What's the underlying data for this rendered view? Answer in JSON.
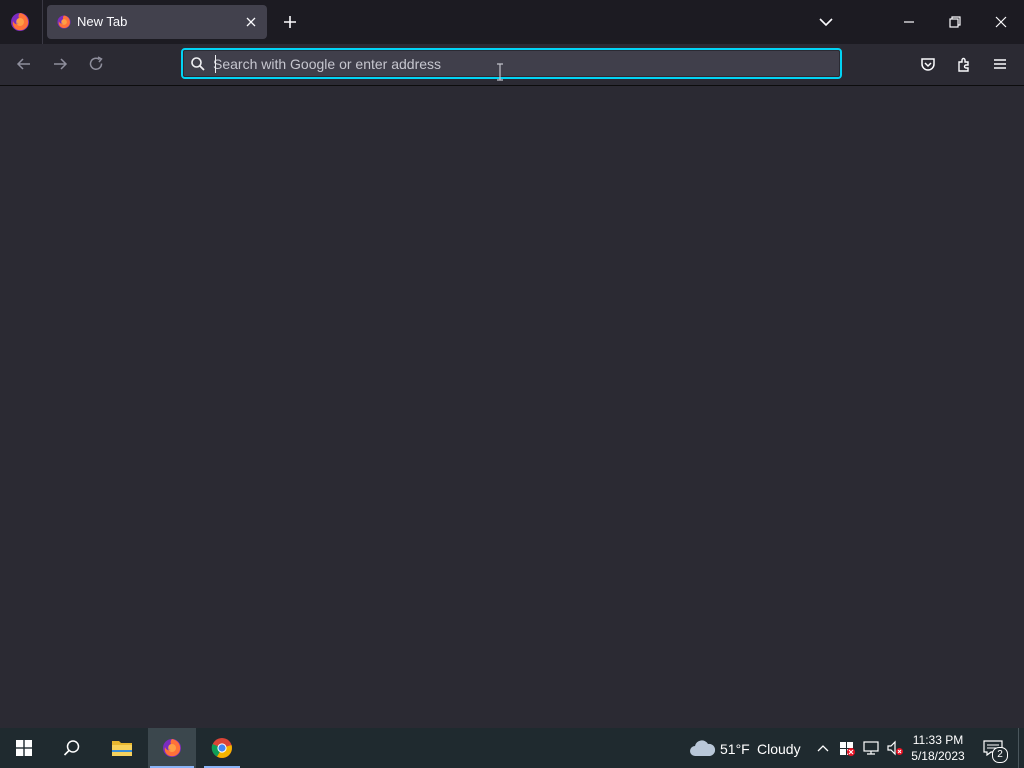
{
  "browser": {
    "tab": {
      "title": "New Tab",
      "close_icon": "close-icon",
      "favicon": "firefox-icon"
    },
    "new_tab_icon": "plus-icon",
    "tab_list_icon": "chevron-down-icon",
    "window_controls": [
      "minimize-icon",
      "restore-icon",
      "close-icon"
    ],
    "nav": {
      "back_icon": "arrow-left-icon",
      "forward_icon": "arrow-right-icon",
      "reload_icon": "reload-icon"
    },
    "urlbar": {
      "placeholder": "Search with Google or enter address",
      "value": "",
      "icon": "search-icon"
    },
    "toolbar_icons": [
      "pocket-icon",
      "extensions-icon",
      "menu-icon"
    ]
  },
  "taskbar": {
    "items": [
      "windows-start-icon",
      "search-icon",
      "file-explorer-icon",
      "firefox-icon",
      "chrome-icon"
    ],
    "active_item": "firefox-icon",
    "weather": {
      "temperature": "51°F",
      "condition": "Cloudy",
      "icon": "cloud-icon"
    },
    "tray_icons": [
      "chevron-up-icon",
      "security-icon",
      "network-icon",
      "volume-muted-icon"
    ],
    "time": "11:33 PM",
    "date": "5/18/2023",
    "notifications": {
      "count": "2",
      "icon": "notifications-icon"
    }
  },
  "colors": {
    "accent": "#00ddff",
    "tabbar_bg": "#1c1b22",
    "page_bg": "#2b2a33",
    "taskbar_bg": "#1f2a2f"
  }
}
